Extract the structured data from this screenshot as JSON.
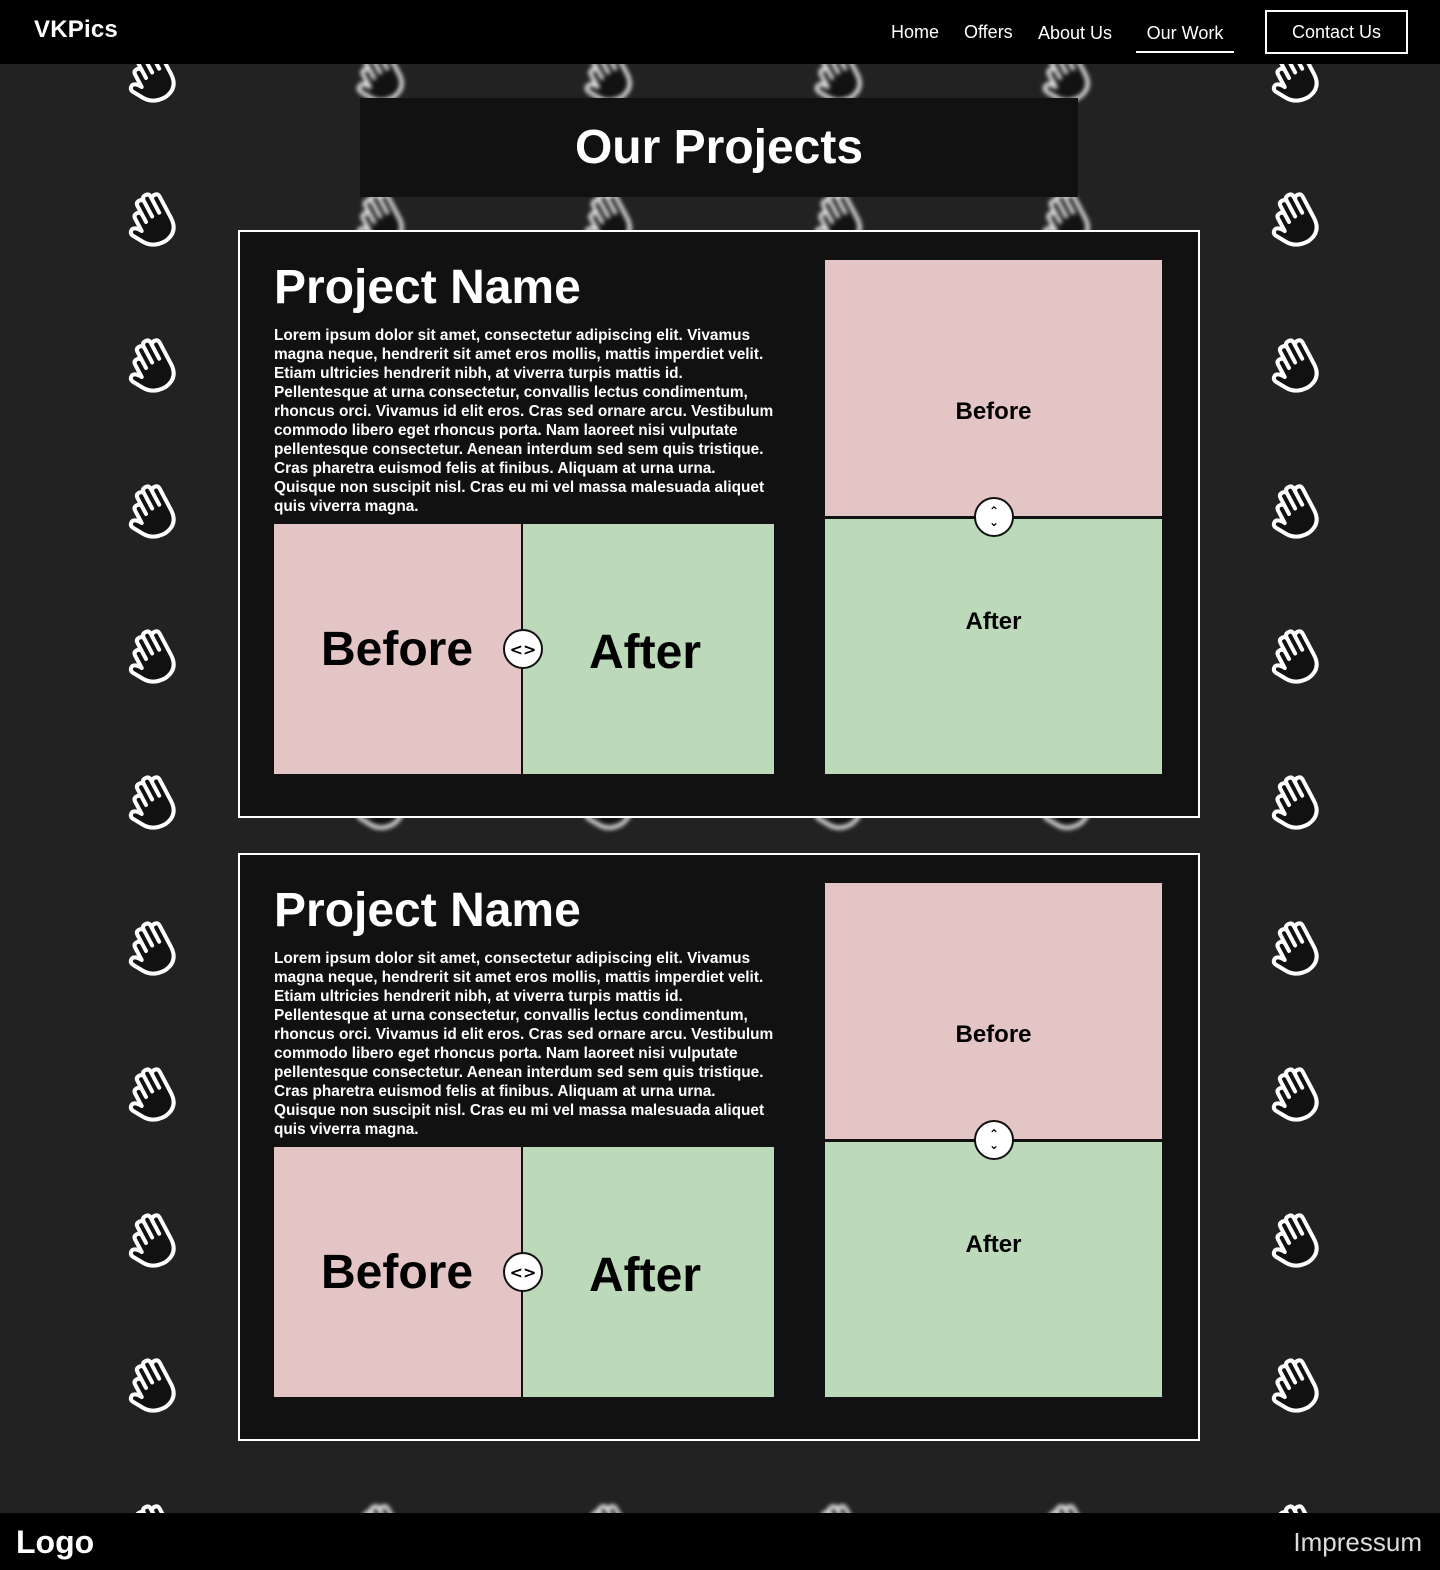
{
  "header": {
    "brand": "VKPics",
    "nav": {
      "home": "Home",
      "offers": "Offers",
      "about": "About Us",
      "work": "Our Work",
      "contact": "Contact Us"
    },
    "active": "Our Work"
  },
  "page": {
    "title": "Our Projects"
  },
  "projects": [
    {
      "name": "Project Name",
      "description": "Lorem ipsum dolor sit amet, consectetur adipiscing elit. Vivamus magna neque, hendrerit sit amet eros mollis, mattis imperdiet velit. Etiam ultricies hendrerit nibh, at viverra turpis mattis id. Pellentesque at urna consectetur, convallis lectus condimentum, rhoncus orci. Vivamus id elit eros. Cras sed ornare arcu. Vestibulum commodo libero eget rhoncus porta. Nam laoreet nisi vulputate pellentesque consectetur. Aenean interdum sed sem quis tristique. Cras pharetra euismod felis at finibus. Aliquam at urna urna. Quisque non suscipit nisl. Cras eu mi vel massa malesuada aliquet quis viverra magna.",
      "compare_horizontal": {
        "before": "Before",
        "after": "After",
        "handle": "<>"
      },
      "compare_vertical": {
        "before": "Before",
        "after": "After"
      }
    },
    {
      "name": "Project Name",
      "description": "Lorem ipsum dolor sit amet, consectetur adipiscing elit. Vivamus magna neque, hendrerit sit amet eros mollis, mattis imperdiet velit. Etiam ultricies hendrerit nibh, at viverra turpis mattis id. Pellentesque at urna consectetur, convallis lectus condimentum, rhoncus orci. Vivamus id elit eros. Cras sed ornare arcu. Vestibulum commodo libero eget rhoncus porta. Nam laoreet nisi vulputate pellentesque consectetur. Aenean interdum sed sem quis tristique. Cras pharetra euismod felis at finibus. Aliquam at urna urna. Quisque non suscipit nisl. Cras eu mi vel massa malesuada aliquet quis viverra magna.",
      "compare_horizontal": {
        "before": "Before",
        "after": "After",
        "handle": "<>"
      },
      "compare_vertical": {
        "before": "Before",
        "after": "After"
      }
    }
  ],
  "footer": {
    "logo": "Logo",
    "impressum": "Impressum"
  },
  "colors": {
    "background": "#222222",
    "navbar": "#000000",
    "card": "#111111",
    "before": "#e3c5c6",
    "after": "#bcd9b9"
  },
  "icons": {
    "background_pattern": "waving-hand-icon",
    "slider_handle_horizontal": "left-right-arrows-icon",
    "slider_handle_vertical": "up-down-arrows-icon"
  }
}
